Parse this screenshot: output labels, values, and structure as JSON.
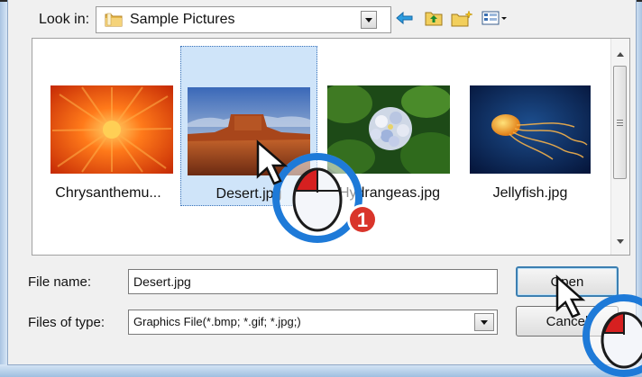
{
  "dialog": {
    "look_in_label": "Look in:",
    "look_in_value": "Sample Pictures",
    "toolbar_icons": [
      "back-arrow-icon",
      "up-folder-icon",
      "new-folder-icon",
      "view-menu-icon"
    ]
  },
  "files": [
    {
      "name": "Chrysanthemu...",
      "thumbnail": "chrysanthemum-thumbnail",
      "selected": false
    },
    {
      "name": "Desert.jpg",
      "thumbnail": "desert-thumbnail",
      "selected": true
    },
    {
      "name": "Hydrangeas.jpg",
      "thumbnail": "hydrangeas-thumbnail",
      "selected": false
    },
    {
      "name": "Jellyfish.jpg",
      "thumbnail": "jellyfish-thumbnail",
      "selected": false
    }
  ],
  "form": {
    "file_name_label": "File name:",
    "file_name_value": "Desert.jpg",
    "file_type_label": "Files of type:",
    "file_type_value": "Graphics File(*.bmp; *.gif; *.jpg;)",
    "open_button": "Open",
    "cancel_button": "Cancel"
  },
  "annotation": {
    "step_badge": "1",
    "badge_color": "#d9352b",
    "cursor_ring_color": "#1e7ad8"
  },
  "colors": {
    "selection": "#cfe4f9",
    "window_frame": "#c9ddf1",
    "dialog_bg": "#f0f0f0"
  }
}
